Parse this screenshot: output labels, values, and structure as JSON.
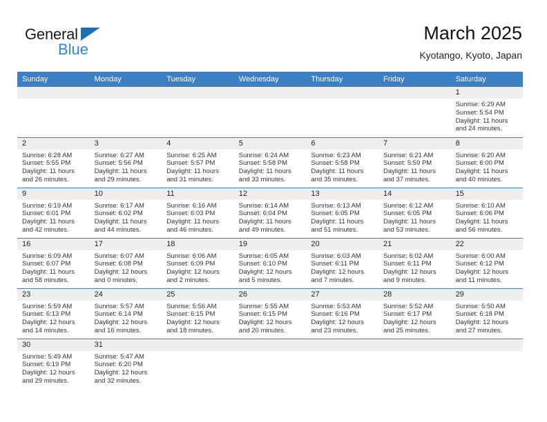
{
  "brand": {
    "name_top": "General",
    "name_bottom": "Blue",
    "accent_color": "#2f86d4",
    "triangle_color": "#1f6fb5"
  },
  "header": {
    "title": "March 2025",
    "subtitle": "Kyotango, Kyoto, Japan",
    "header_bg": "#3b7fc4",
    "daynum_bg": "#efefef"
  },
  "weekday_headers": [
    "Sunday",
    "Monday",
    "Tuesday",
    "Wednesday",
    "Thursday",
    "Friday",
    "Saturday"
  ],
  "labels": {
    "sunrise": "Sunrise:",
    "sunset": "Sunset:",
    "daylight": "Daylight:"
  },
  "weeks": [
    [
      {
        "day": "",
        "blank": true
      },
      {
        "day": "",
        "blank": true
      },
      {
        "day": "",
        "blank": true
      },
      {
        "day": "",
        "blank": true
      },
      {
        "day": "",
        "blank": true
      },
      {
        "day": "",
        "blank": true
      },
      {
        "day": "1",
        "sunrise": "Sunrise: 6:29 AM",
        "sunset": "Sunset: 5:54 PM",
        "daylight": "Daylight: 11 hours and 24 minutes."
      }
    ],
    [
      {
        "day": "2",
        "sunrise": "Sunrise: 6:28 AM",
        "sunset": "Sunset: 5:55 PM",
        "daylight": "Daylight: 11 hours and 26 minutes."
      },
      {
        "day": "3",
        "sunrise": "Sunrise: 6:27 AM",
        "sunset": "Sunset: 5:56 PM",
        "daylight": "Daylight: 11 hours and 29 minutes."
      },
      {
        "day": "4",
        "sunrise": "Sunrise: 6:25 AM",
        "sunset": "Sunset: 5:57 PM",
        "daylight": "Daylight: 11 hours and 31 minutes."
      },
      {
        "day": "5",
        "sunrise": "Sunrise: 6:24 AM",
        "sunset": "Sunset: 5:58 PM",
        "daylight": "Daylight: 11 hours and 33 minutes."
      },
      {
        "day": "6",
        "sunrise": "Sunrise: 6:23 AM",
        "sunset": "Sunset: 5:58 PM",
        "daylight": "Daylight: 11 hours and 35 minutes."
      },
      {
        "day": "7",
        "sunrise": "Sunrise: 6:21 AM",
        "sunset": "Sunset: 5:59 PM",
        "daylight": "Daylight: 11 hours and 37 minutes."
      },
      {
        "day": "8",
        "sunrise": "Sunrise: 6:20 AM",
        "sunset": "Sunset: 6:00 PM",
        "daylight": "Daylight: 11 hours and 40 minutes."
      }
    ],
    [
      {
        "day": "9",
        "sunrise": "Sunrise: 6:19 AM",
        "sunset": "Sunset: 6:01 PM",
        "daylight": "Daylight: 11 hours and 42 minutes."
      },
      {
        "day": "10",
        "sunrise": "Sunrise: 6:17 AM",
        "sunset": "Sunset: 6:02 PM",
        "daylight": "Daylight: 11 hours and 44 minutes."
      },
      {
        "day": "11",
        "sunrise": "Sunrise: 6:16 AM",
        "sunset": "Sunset: 6:03 PM",
        "daylight": "Daylight: 11 hours and 46 minutes."
      },
      {
        "day": "12",
        "sunrise": "Sunrise: 6:14 AM",
        "sunset": "Sunset: 6:04 PM",
        "daylight": "Daylight: 11 hours and 49 minutes."
      },
      {
        "day": "13",
        "sunrise": "Sunrise: 6:13 AM",
        "sunset": "Sunset: 6:05 PM",
        "daylight": "Daylight: 11 hours and 51 minutes."
      },
      {
        "day": "14",
        "sunrise": "Sunrise: 6:12 AM",
        "sunset": "Sunset: 6:05 PM",
        "daylight": "Daylight: 11 hours and 53 minutes."
      },
      {
        "day": "15",
        "sunrise": "Sunrise: 6:10 AM",
        "sunset": "Sunset: 6:06 PM",
        "daylight": "Daylight: 11 hours and 56 minutes."
      }
    ],
    [
      {
        "day": "16",
        "sunrise": "Sunrise: 6:09 AM",
        "sunset": "Sunset: 6:07 PM",
        "daylight": "Daylight: 11 hours and 58 minutes."
      },
      {
        "day": "17",
        "sunrise": "Sunrise: 6:07 AM",
        "sunset": "Sunset: 6:08 PM",
        "daylight": "Daylight: 12 hours and 0 minutes."
      },
      {
        "day": "18",
        "sunrise": "Sunrise: 6:06 AM",
        "sunset": "Sunset: 6:09 PM",
        "daylight": "Daylight: 12 hours and 2 minutes."
      },
      {
        "day": "19",
        "sunrise": "Sunrise: 6:05 AM",
        "sunset": "Sunset: 6:10 PM",
        "daylight": "Daylight: 12 hours and 5 minutes."
      },
      {
        "day": "20",
        "sunrise": "Sunrise: 6:03 AM",
        "sunset": "Sunset: 6:11 PM",
        "daylight": "Daylight: 12 hours and 7 minutes."
      },
      {
        "day": "21",
        "sunrise": "Sunrise: 6:02 AM",
        "sunset": "Sunset: 6:11 PM",
        "daylight": "Daylight: 12 hours and 9 minutes."
      },
      {
        "day": "22",
        "sunrise": "Sunrise: 6:00 AM",
        "sunset": "Sunset: 6:12 PM",
        "daylight": "Daylight: 12 hours and 11 minutes."
      }
    ],
    [
      {
        "day": "23",
        "sunrise": "Sunrise: 5:59 AM",
        "sunset": "Sunset: 6:13 PM",
        "daylight": "Daylight: 12 hours and 14 minutes."
      },
      {
        "day": "24",
        "sunrise": "Sunrise: 5:57 AM",
        "sunset": "Sunset: 6:14 PM",
        "daylight": "Daylight: 12 hours and 16 minutes."
      },
      {
        "day": "25",
        "sunrise": "Sunrise: 5:56 AM",
        "sunset": "Sunset: 6:15 PM",
        "daylight": "Daylight: 12 hours and 18 minutes."
      },
      {
        "day": "26",
        "sunrise": "Sunrise: 5:55 AM",
        "sunset": "Sunset: 6:15 PM",
        "daylight": "Daylight: 12 hours and 20 minutes."
      },
      {
        "day": "27",
        "sunrise": "Sunrise: 5:53 AM",
        "sunset": "Sunset: 6:16 PM",
        "daylight": "Daylight: 12 hours and 23 minutes."
      },
      {
        "day": "28",
        "sunrise": "Sunrise: 5:52 AM",
        "sunset": "Sunset: 6:17 PM",
        "daylight": "Daylight: 12 hours and 25 minutes."
      },
      {
        "day": "29",
        "sunrise": "Sunrise: 5:50 AM",
        "sunset": "Sunset: 6:18 PM",
        "daylight": "Daylight: 12 hours and 27 minutes."
      }
    ],
    [
      {
        "day": "30",
        "sunrise": "Sunrise: 5:49 AM",
        "sunset": "Sunset: 6:19 PM",
        "daylight": "Daylight: 12 hours and 29 minutes."
      },
      {
        "day": "31",
        "sunrise": "Sunrise: 5:47 AM",
        "sunset": "Sunset: 6:20 PM",
        "daylight": "Daylight: 12 hours and 32 minutes."
      },
      {
        "day": "",
        "blank": true
      },
      {
        "day": "",
        "blank": true
      },
      {
        "day": "",
        "blank": true
      },
      {
        "day": "",
        "blank": true
      },
      {
        "day": "",
        "blank": true
      }
    ]
  ]
}
